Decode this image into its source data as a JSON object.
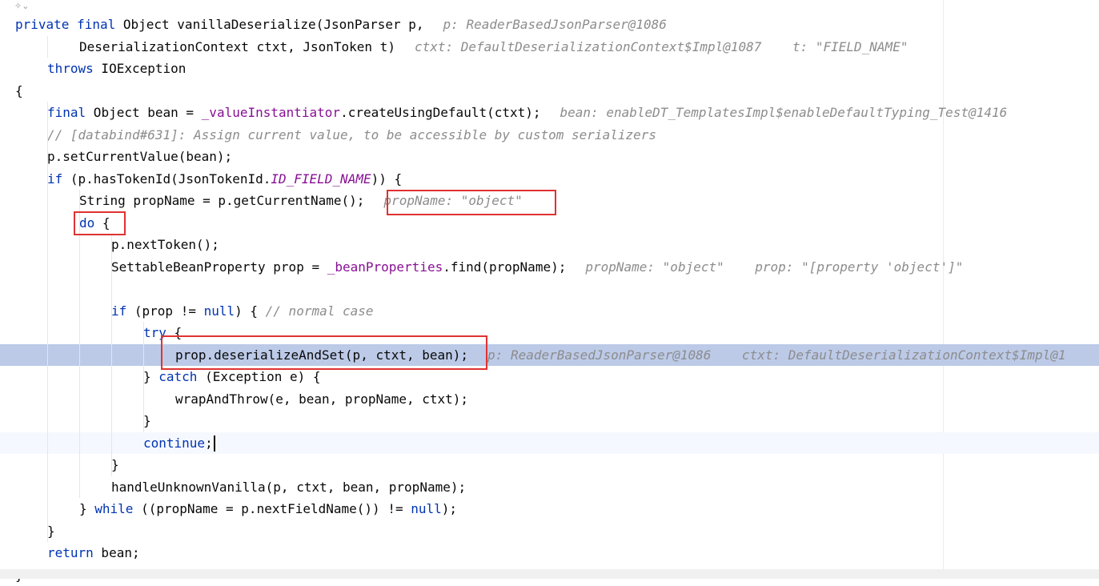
{
  "editor": {
    "fold_icon": "inlay-hint-icon",
    "lines": [
      {
        "indent": 0,
        "code_html": "<span class='kw'>private final</span> Object vanillaDeserialize(JsonParser p,",
        "hint": "p: ReaderBasedJsonParser@1086"
      },
      {
        "indent": 2,
        "code_html": "DeserializationContext ctxt, JsonToken t)",
        "hint": "ctxt: DefaultDeserializationContext$Impl@1087    t: \"FIELD_NAME\""
      },
      {
        "indent": 1,
        "code_html": "<span class='kw'>throws</span> IOException",
        "hint": ""
      },
      {
        "indent": 0,
        "code_html": "{",
        "hint": ""
      },
      {
        "indent": 1,
        "code_html": "<span class='kw'>final</span> Object bean = <span class='field'>_valueInstantiator</span>.createUsingDefault(ctxt);",
        "hint": "bean: enableDT_TemplatesImpl$enableDefaultTyping_Test@1416"
      },
      {
        "indent": 1,
        "code_html": "<span class='cmt'>// [databind#631]: Assign current value, to be accessible by custom serializers</span>",
        "hint": ""
      },
      {
        "indent": 1,
        "code_html": "p.setCurrentValue(bean);",
        "hint": ""
      },
      {
        "indent": 1,
        "code_html": "<span class='kw'>if</span> (p.hasTokenId(JsonTokenId.<span class='field' style='font-style:italic'>ID_FIELD_NAME</span>)) {",
        "hint": ""
      },
      {
        "indent": 2,
        "code_html": "String propName = p.getCurrentName();",
        "hint": "propName: \"object\""
      },
      {
        "indent": 2,
        "code_html": "<span class='kw'>do</span> {",
        "hint": ""
      },
      {
        "indent": 3,
        "code_html": "p.nextToken();",
        "hint": ""
      },
      {
        "indent": 3,
        "code_html": "SettableBeanProperty prop = <span class='field'>_beanProperties</span>.find(propName);",
        "hint": "propName: \"object\"    prop: \"[property 'object']\""
      },
      {
        "indent": 0,
        "code_html": "",
        "hint": ""
      },
      {
        "indent": 3,
        "code_html": "<span class='kw'>if</span> (prop != <span class='kw'>null</span>) { <span class='cmt'>// normal case</span>",
        "hint": ""
      },
      {
        "indent": 4,
        "code_html": "<span class='kw'>try</span> {",
        "hint": ""
      },
      {
        "indent": 5,
        "code_html": "prop.deserializeAndSet(p, ctxt, bean);",
        "hint": "p: ReaderBasedJsonParser@1086    ctxt: DefaultDeserializationContext$Impl@1"
      },
      {
        "indent": 4,
        "code_html": "} <span class='kw'>catch</span> (Exception e) {",
        "hint": ""
      },
      {
        "indent": 5,
        "code_html": "wrapAndThrow(e, bean, propName, ctxt);",
        "hint": ""
      },
      {
        "indent": 4,
        "code_html": "}",
        "hint": ""
      },
      {
        "indent": 4,
        "code_html": "<span class='kw'>continue</span>;",
        "hint": ""
      },
      {
        "indent": 3,
        "code_html": "}",
        "hint": ""
      },
      {
        "indent": 3,
        "code_html": "handleUnknownVanilla(p, ctxt, bean, propName);",
        "hint": ""
      },
      {
        "indent": 2,
        "code_html": "} <span class='kw'>while</span> ((propName = p.nextFieldName()) != <span class='kw'>null</span>);",
        "hint": ""
      },
      {
        "indent": 1,
        "code_html": "}",
        "hint": ""
      },
      {
        "indent": 1,
        "code_html": "<span class='kw'>return</span> bean;",
        "hint": ""
      },
      {
        "indent": 0,
        "code_html": "}",
        "hint": ""
      }
    ],
    "execution_line": 15,
    "caret_line": 19
  },
  "highlight_colors": {
    "keyword": "#0033b3",
    "field": "#871094",
    "comment": "#8c8c8c",
    "execution_line_bg": "#bccae8",
    "annotation_box": "#e03232"
  }
}
